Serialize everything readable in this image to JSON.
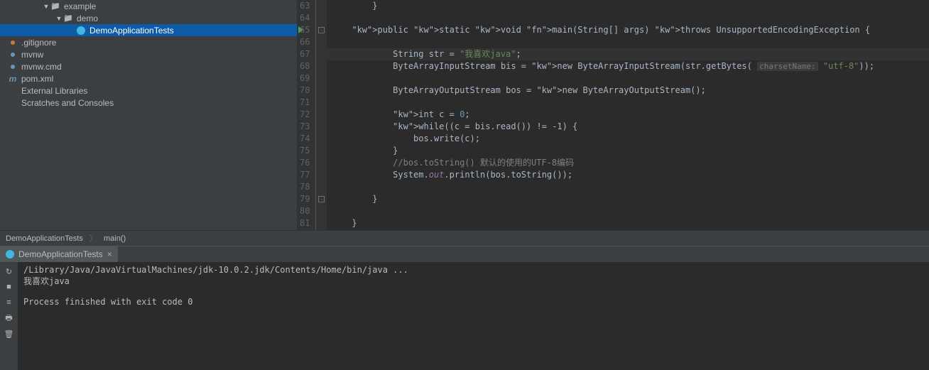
{
  "tree": {
    "items": [
      {
        "indent": 60,
        "arrow": "▼",
        "icon": "folder",
        "label": "example"
      },
      {
        "indent": 78,
        "arrow": "▼",
        "icon": "folder",
        "label": "demo"
      },
      {
        "indent": 96,
        "arrow": "",
        "icon": "java",
        "label": "DemoApplicationTests",
        "selected": true
      },
      {
        "indent": 0,
        "arrow": "",
        "icon": "dot-orange",
        "label": ".gitignore"
      },
      {
        "indent": 0,
        "arrow": "",
        "icon": "dot-blue",
        "label": "mvnw"
      },
      {
        "indent": 0,
        "arrow": "",
        "icon": "dot-blue",
        "label": "mvnw.cmd"
      },
      {
        "indent": 0,
        "arrow": "",
        "icon": "m",
        "label": "pom.xml"
      },
      {
        "indent": 0,
        "arrow": "",
        "icon": "",
        "label": "External Libraries"
      },
      {
        "indent": 0,
        "arrow": "",
        "icon": "",
        "label": "Scratches and Consoles"
      }
    ]
  },
  "editor": {
    "first_line": 63,
    "run_line": 65,
    "caret_line": 67,
    "lines": [
      "        }",
      "",
      "    public static void main(String[] args) throws UnsupportedEncodingException {",
      "",
      "            String str = \"我喜欢java\";",
      "            ByteArrayInputStream bis = new ByteArrayInputStream(str.getBytes( charsetName: \"utf-8\"));",
      "",
      "            ByteArrayOutputStream bos = new ByteArrayOutputStream();",
      "",
      "            int c = 0;",
      "            while((c = bis.read()) != -1) {",
      "                bos.write(c);",
      "            }",
      "            //bos.toString() 默认的使用的UTF-8编码",
      "            System.out.println(bos.toString());",
      "",
      "        }",
      "",
      "    }"
    ]
  },
  "breadcrumb": {
    "class": "DemoApplicationTests",
    "method": "main()"
  },
  "console": {
    "tab": "DemoApplicationTests",
    "lines": [
      "/Library/Java/JavaVirtualMachines/jdk-10.0.2.jdk/Contents/Home/bin/java ...",
      "我喜欢java",
      "",
      "Process finished with exit code 0"
    ]
  }
}
